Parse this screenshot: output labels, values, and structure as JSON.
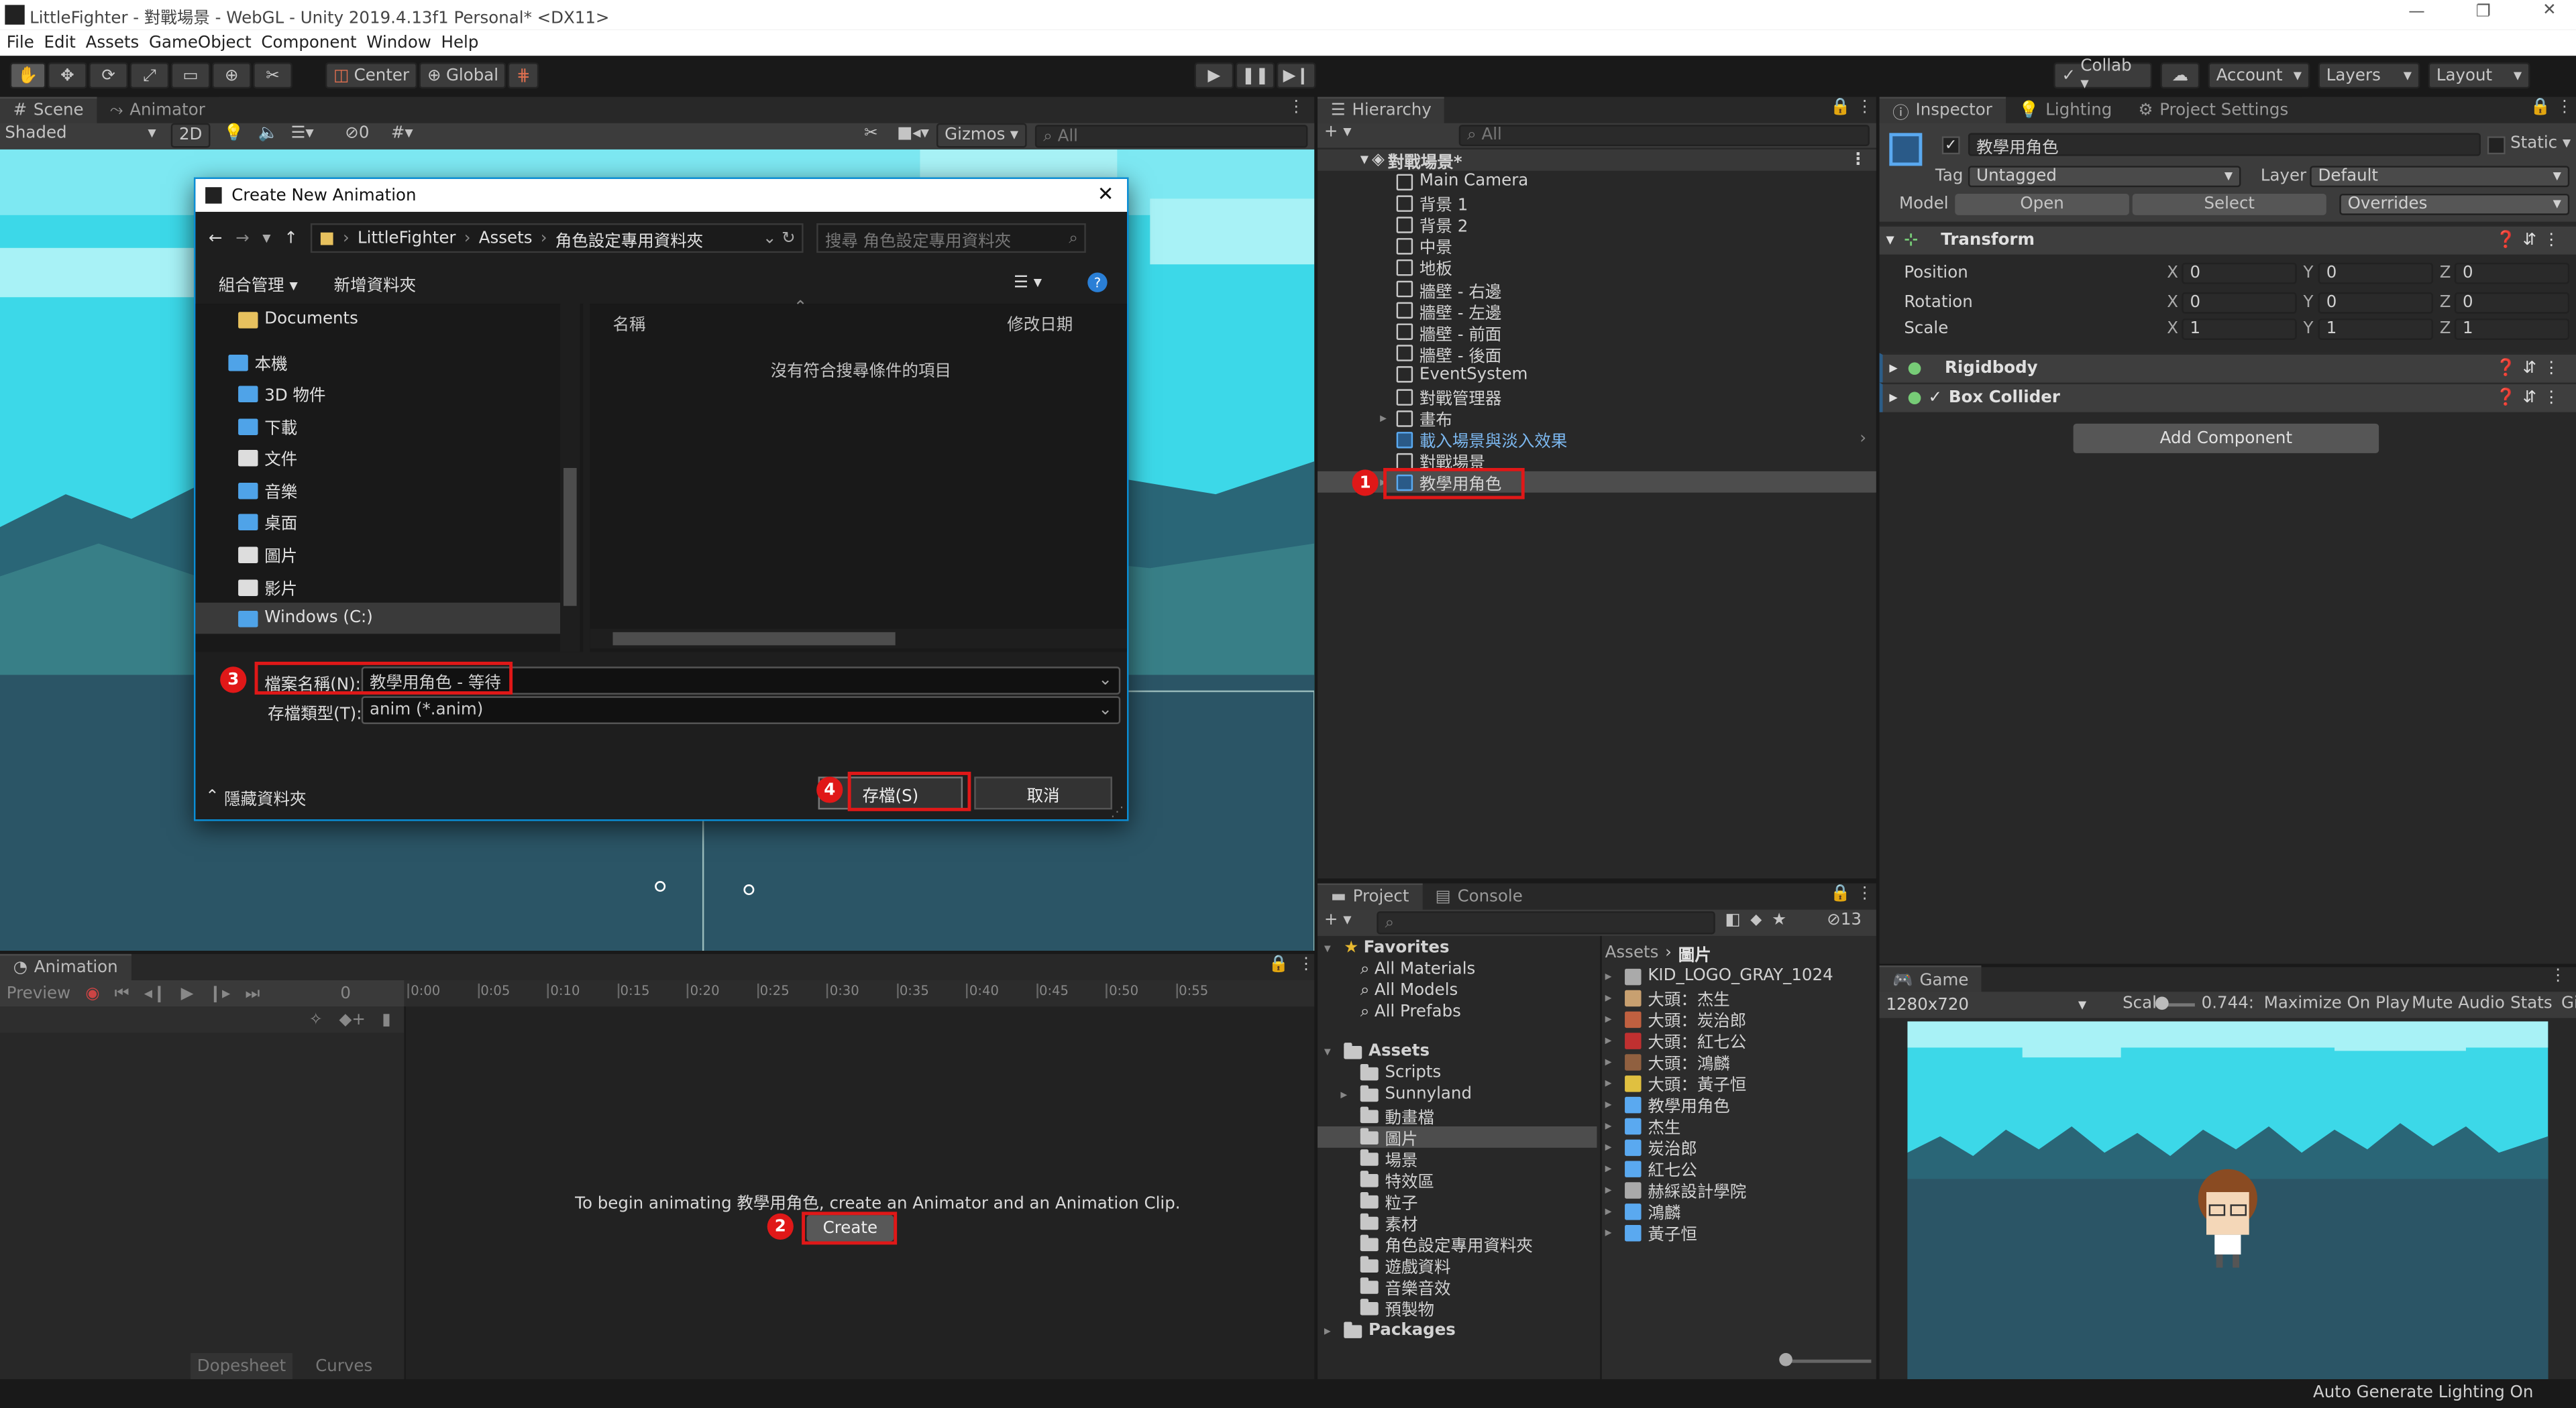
{
  "titlebar": {
    "title": "LittleFighter - 對戰場景 - WebGL - Unity 2019.4.13f1 Personal* <DX11>"
  },
  "menu": [
    "File",
    "Edit",
    "Assets",
    "GameObject",
    "Component",
    "Window",
    "Help"
  ],
  "toolbar": {
    "center": "Center",
    "global": "Global",
    "collab": "Collab ▾",
    "account": "Account",
    "layers": "Layers",
    "layout": "Layout"
  },
  "scene": {
    "tab_scene": "Scene",
    "tab_animator": "Animator",
    "shaded": "Shaded",
    "mode2d": "2D",
    "gizmos": "Gizmos",
    "search_placeholder": "All",
    "vis_count": "0"
  },
  "dialog": {
    "title": "Create New Animation",
    "path": [
      "LittleFighter",
      "Assets",
      "角色設定專用資料夾"
    ],
    "search_placeholder": "搜尋 角色設定專用資料夾",
    "organize": "組合管理 ▾",
    "new_folder": "新增資料夾",
    "nav_items": [
      "Documents",
      "本機",
      "3D 物件",
      "下載",
      "文件",
      "音樂",
      "桌面",
      "圖片",
      "影片",
      "Windows (C:)"
    ],
    "col_name": "名稱",
    "col_date": "修改日期",
    "empty": "沒有符合搜尋條件的項目",
    "filename_label": "檔案名稱(N):",
    "filename_value": "教學用角色 - 等待",
    "filetype_label": "存檔類型(T):",
    "filetype_value": "anim (*.anim)",
    "hide_folders": "隱藏資料夾",
    "save": "存檔(S)",
    "cancel": "取消"
  },
  "animation": {
    "tab": "Animation",
    "preview": "Preview",
    "frame": "0",
    "times": [
      "0:00",
      "0:05",
      "0:10",
      "0:15",
      "0:20",
      "0:25",
      "0:30",
      "0:35",
      "0:40",
      "0:45",
      "0:50",
      "0:55"
    ],
    "message": "To begin animating 教學用角色, create an Animator and an Animation Clip.",
    "create": "Create",
    "dopesheet": "Dopesheet",
    "curves": "Curves"
  },
  "hierarchy": {
    "tab": "Hierarchy",
    "search_placeholder": "All",
    "scene": "對戰場景*",
    "items": [
      "Main Camera",
      "背景 1",
      "背景 2",
      "中景",
      "地板",
      "牆壁 - 右邊",
      "牆壁 - 左邊",
      "牆壁 - 前面",
      "牆壁 - 後面",
      "EventSystem",
      "對戰管理器",
      "畫布",
      "載入場景與淡入效果",
      "對戰場景",
      "教學用角色"
    ]
  },
  "inspector": {
    "tab_inspector": "Inspector",
    "tab_lighting": "Lighting",
    "tab_settings": "Project Settings",
    "name": "教學用角色",
    "static": "Static",
    "tag_label": "Tag",
    "tag_value": "Untagged",
    "layer_label": "Layer",
    "layer_value": "Default",
    "model_label": "Model",
    "open": "Open",
    "select": "Select",
    "overrides": "Overrides",
    "transform": "Transform",
    "position": "Position",
    "rotation": "Rotation",
    "scale": "Scale",
    "pos": [
      "0",
      "0",
      "0"
    ],
    "rot": [
      "0",
      "0",
      "0"
    ],
    "scl": [
      "1",
      "1",
      "1"
    ],
    "rigidbody": "Rigidbody",
    "boxcollider": "Box Collider",
    "add_component": "Add Component",
    "axis": [
      "X",
      "Y",
      "Z"
    ]
  },
  "project": {
    "tab_project": "Project",
    "tab_console": "Console",
    "hidden_count": "13",
    "favorites": "Favorites",
    "fav_items": [
      "All Materials",
      "All Models",
      "All Prefabs"
    ],
    "assets": "Assets",
    "asset_folders": [
      "Scripts",
      "Sunnyland",
      "動畫檔",
      "圖片",
      "場景",
      "特效區",
      "粒子",
      "素材",
      "角色設定專用資料夾",
      "遊戲資料",
      "音樂音效",
      "預製物"
    ],
    "packages": "Packages",
    "breadcrumb_root": "Assets",
    "breadcrumb_leaf": "圖片",
    "files": [
      "KID_LOGO_GRAY_1024",
      "大頭：杰生",
      "大頭：炭治郎",
      "大頭：紅七公",
      "大頭：鴻麟",
      "大頭：黃子恒",
      "教學用角色",
      "杰生",
      "炭治郎",
      "紅七公",
      "赫綵設計學院",
      "鴻麟",
      "黃子恒"
    ]
  },
  "game": {
    "tab": "Game",
    "resolution": "1280x720",
    "scale_label": "Scale",
    "scale_value": "0.744:",
    "maximize": "Maximize On Play",
    "mute": "Mute Audio",
    "stats": "Stats",
    "gizmos": "Gi"
  },
  "statusbar": {
    "text": "Auto Generate Lighting On"
  },
  "steps": [
    "1",
    "2",
    "3",
    "4"
  ],
  "colors": {
    "accent_red": "#e01818",
    "sky": "#3cd8e8",
    "sea": "#2a6677",
    "selection": "#2c5d87"
  }
}
